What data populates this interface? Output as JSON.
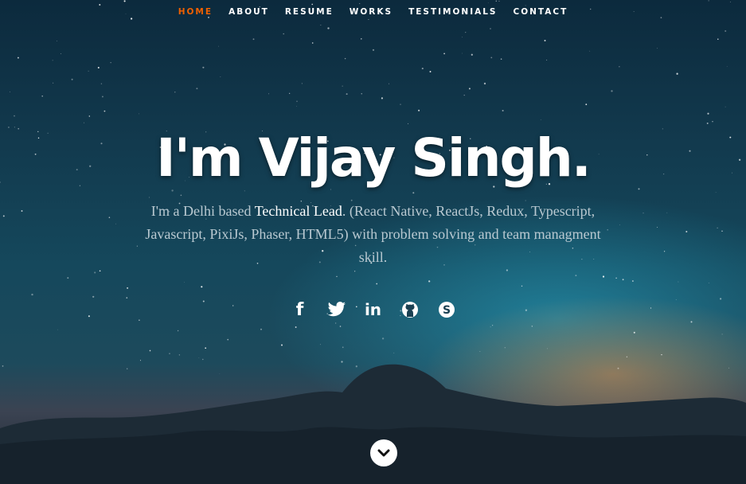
{
  "nav": {
    "items": [
      {
        "label": "HOME",
        "active": true
      },
      {
        "label": "ABOUT"
      },
      {
        "label": "RESUME"
      },
      {
        "label": "WORKS"
      },
      {
        "label": "TESTIMONIALS"
      },
      {
        "label": "CONTACT"
      }
    ]
  },
  "hero": {
    "title": "I'm Vijay Singh.",
    "intro_pre": "I'm a Delhi based ",
    "intro_highlight": "Technical Lead",
    "intro_post": ". (React Native, ReactJs, Redux, Typescript, Javascript, PixiJs, Phaser, HTML5) with problem solving and team managment skill."
  },
  "social": [
    "facebook-icon",
    "twitter-icon",
    "linkedin-icon",
    "github-icon",
    "skype-icon"
  ],
  "colors": {
    "accent": "#f06000",
    "text": "#ffffff",
    "muted_text": "#b9c9d1"
  }
}
